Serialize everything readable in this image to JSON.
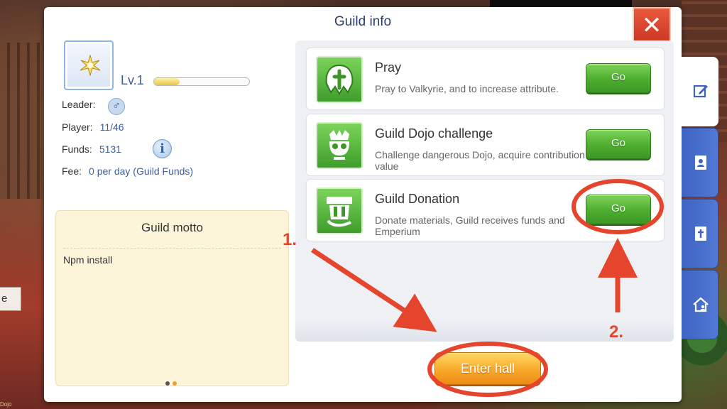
{
  "window": {
    "title": "Guild info",
    "close_icon": "close-icon"
  },
  "profile": {
    "level": "Lv.1",
    "xp_fraction": 0.27,
    "leader_label": "Leader:",
    "gender_symbol": "♂",
    "player_label": "Player:",
    "player_value": "11/46",
    "funds_label": "Funds:",
    "funds_value": "5131",
    "info_symbol": "i",
    "fee_label": "Fee:",
    "fee_value": "0 per day (Guild Funds)"
  },
  "motto": {
    "title": "Guild motto",
    "text": "Npm install",
    "pages": 2,
    "active_page": 1
  },
  "activities": [
    {
      "title": "Pray",
      "description": "Pray to Valkyrie, and to increase attribute.",
      "button": "Go",
      "icon": "pray-icon"
    },
    {
      "title": "Guild Dojo challenge",
      "description": "Challenge dangerous Dojo, acquire contribution value",
      "button": "Go",
      "icon": "skull-icon"
    },
    {
      "title": "Guild Donation",
      "description": "Donate materials, Guild receives funds and Emperium",
      "button": "Go",
      "icon": "donation-icon"
    }
  ],
  "enter_hall": "Enter hall",
  "side_tabs": [
    "edit-icon",
    "member-list-icon",
    "cross-book-icon",
    "guild-house-icon"
  ],
  "background": {
    "left_tag": "e",
    "corner_text": "Dojo"
  },
  "annotations": {
    "step1": "1.",
    "step2": "2.",
    "color": "#e5452d"
  },
  "colors": {
    "link_blue": "#3b5da0",
    "go_green": "#4cad2f",
    "enter_orange": "#f7a92a",
    "tab_blue": "#4a6fcf"
  }
}
